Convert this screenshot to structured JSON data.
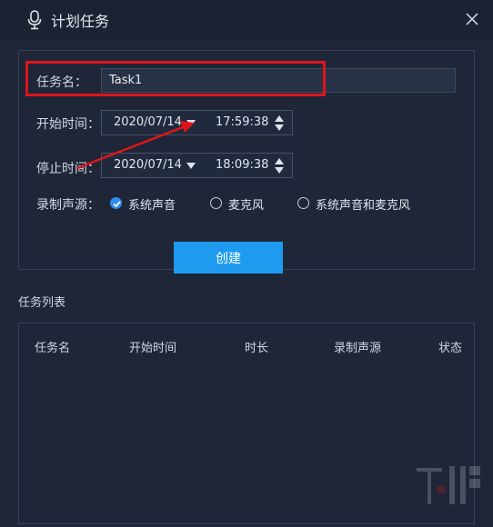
{
  "window": {
    "title": "计划任务",
    "icons": {
      "title_icon": "microphone-icon",
      "close": "close-icon"
    }
  },
  "form": {
    "task_name_label": "任务名：",
    "task_name_value": "Task1",
    "start_label": "开始时间：",
    "start_date": "2020/07/14",
    "start_time": "17:59:38",
    "stop_label": "停止时间：",
    "stop_date": "2020/07/14",
    "stop_time": "18:09:38",
    "audio_source_label": "录制声源：",
    "audio_options": [
      {
        "label": "系统声音",
        "checked": true
      },
      {
        "label": "麦克风",
        "checked": false
      },
      {
        "label": "系统声音和麦克风",
        "checked": false
      }
    ],
    "create_button": "创建"
  },
  "task_list": {
    "title": "任务列表",
    "columns": [
      "任务名",
      "开始时间",
      "时长",
      "录制声源",
      "状态"
    ],
    "rows": []
  },
  "colors": {
    "background": "#1e2638",
    "accent": "#1e9bef",
    "annotation": "#e0141a"
  }
}
